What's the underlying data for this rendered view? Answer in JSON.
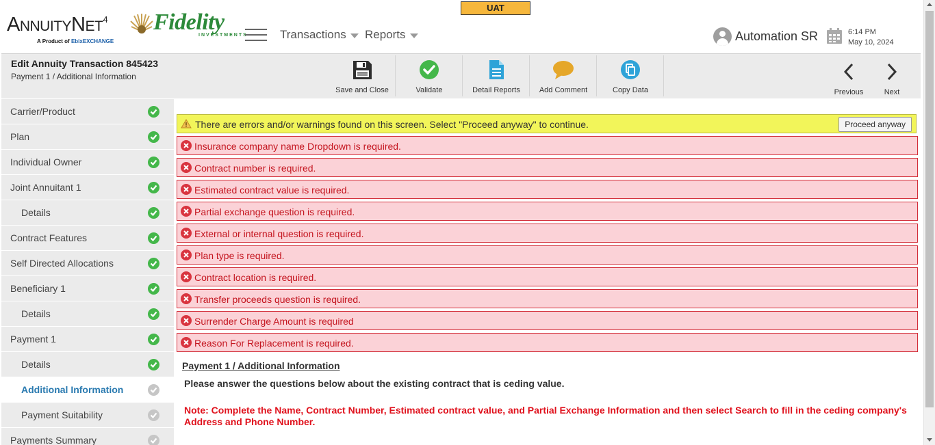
{
  "header": {
    "environment_badge": "UAT",
    "brand": {
      "annuitynet_prefix": "A",
      "annuitynet_mid": "NNUITY",
      "annuitynet_n": "N",
      "annuitynet_et": "ET",
      "annuitynet_version": "4",
      "byline_prefix": "A Product of",
      "byline_ebix": "Ebix",
      "byline_suffix": "EXCHANGE",
      "partner": "Fidelity",
      "partner_sub": "INVESTMENTS"
    },
    "nav": {
      "transactions": "Transactions",
      "reports": "Reports"
    },
    "user_name": "Automation SR",
    "time": "6:14 PM",
    "date": "May 10, 2024"
  },
  "toolbar": {
    "title": "Edit Annuity Transaction 845423",
    "subtitle": "Payment 1 / Additional Information",
    "save_close": "Save and Close",
    "validate": "Validate",
    "detail_reports": "Detail Reports",
    "add_comment": "Add Comment",
    "copy_data": "Copy Data",
    "previous": "Previous",
    "next": "Next"
  },
  "sidebar": {
    "items": [
      {
        "label": "Carrier/Product",
        "status": "complete"
      },
      {
        "label": "Plan",
        "status": "complete"
      },
      {
        "label": "Individual Owner",
        "status": "complete"
      },
      {
        "label": "Joint Annuitant 1",
        "status": "complete"
      },
      {
        "label": "Details",
        "status": "complete"
      },
      {
        "label": "Contract Features",
        "status": "complete"
      },
      {
        "label": "Self Directed Allocations",
        "status": "complete"
      },
      {
        "label": "Beneficiary 1",
        "status": "complete"
      },
      {
        "label": "Details",
        "status": "complete"
      },
      {
        "label": "Payment 1",
        "status": "complete"
      },
      {
        "label": "Details",
        "status": "complete"
      },
      {
        "label": "Additional Information",
        "status": "incomplete"
      },
      {
        "label": "Payment Suitability",
        "status": "incomplete"
      },
      {
        "label": "Payments Summary",
        "status": "incomplete"
      }
    ]
  },
  "messages": {
    "warning": "There are errors and/or warnings found on this screen. Select \"Proceed anyway\" to continue.",
    "proceed_button": "Proceed anyway",
    "errors": [
      "Insurance company name Dropdown is required.",
      "Contract number is required.",
      "Estimated contract value is required.",
      "Partial exchange question is required.",
      "External or internal question is required.",
      "Plan type is required.",
      "Contract location is required.",
      "Transfer proceeds question is required.",
      "Surrender Charge Amount is required",
      "Reason For Replacement is required."
    ]
  },
  "content": {
    "section_title": "Payment 1 / Additional Information",
    "instructions": "Please answer the questions below about the existing contract that is ceding value.",
    "note": "Note: Complete the Name, Contract Number, Estimated contract value, and Partial Exchange Information and then select Search to fill in the ceding company's Address and Phone Number."
  },
  "colors": {
    "complete": "#44b74a",
    "incomplete": "#c6c6c6",
    "error_bg": "#fbd2d7",
    "error_text": "#c4151f",
    "warning_bg": "#f2f55a",
    "active_link": "#2a7ab0",
    "uat_badge": "#f6b73c"
  }
}
